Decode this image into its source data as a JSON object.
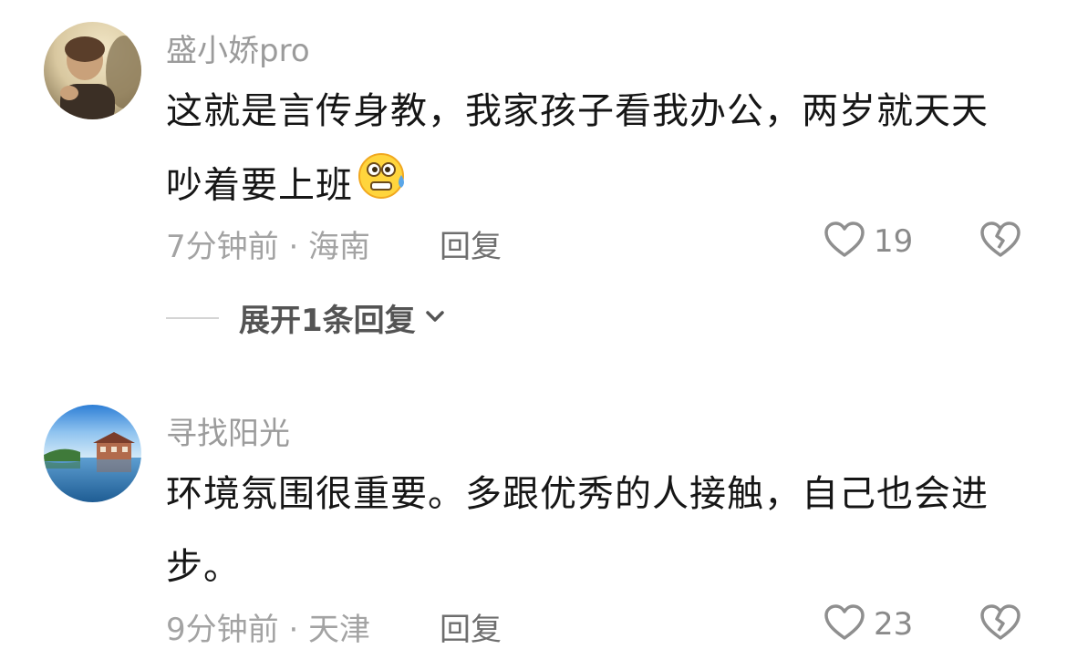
{
  "comments": [
    {
      "username": "盛小娇pro",
      "text": "这就是言传身教，我家孩子看我办公，两岁就天天吵着要上班",
      "emoji": "anxious-sweat-face-emoji",
      "time_location": "7分钟前 · 海南",
      "reply_label": "回复",
      "likes": "19",
      "expand_label": "展开1条回复"
    },
    {
      "username": "寻找阳光",
      "text": "环境氛围很重要。多跟优秀的人接触，自己也会进步。",
      "time_location": "9分钟前 · 天津",
      "reply_label": "回复",
      "likes": "23"
    }
  ],
  "icons": {
    "like": "heart-outline-icon",
    "dislike": "broken-heart-icon",
    "expand": "chevron-down-icon"
  },
  "colors": {
    "username": "#9b9b9b",
    "text": "#161616",
    "meta": "#a3a3a3"
  }
}
